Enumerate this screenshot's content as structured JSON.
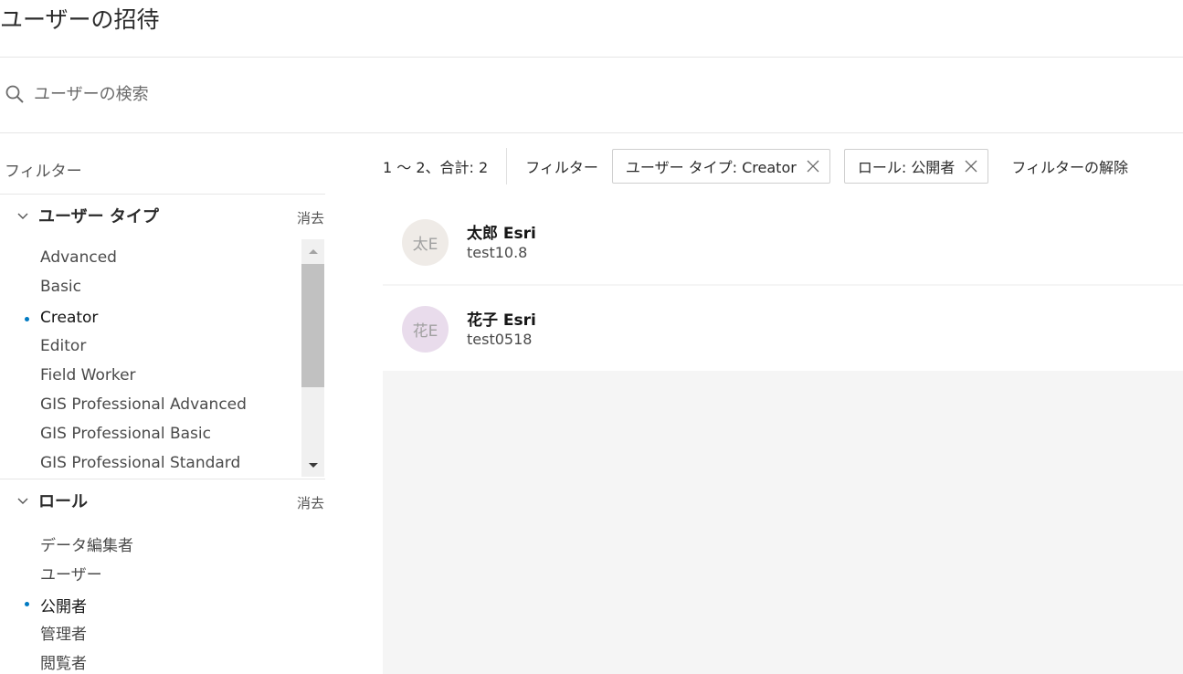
{
  "title": "ユーザーの招待",
  "search": {
    "placeholder": "ユーザーの検索"
  },
  "filters": {
    "heading": "フィルター",
    "user_type": {
      "label": "ユーザー タイプ",
      "clear_label": "消去",
      "options": [
        {
          "label": "Advanced",
          "selected": false
        },
        {
          "label": "Basic",
          "selected": false
        },
        {
          "label": "Creator",
          "selected": true
        },
        {
          "label": "Editor",
          "selected": false
        },
        {
          "label": "Field Worker",
          "selected": false
        },
        {
          "label": "GIS Professional Advanced",
          "selected": false
        },
        {
          "label": "GIS Professional Basic",
          "selected": false
        },
        {
          "label": "GIS Professional Standard",
          "selected": false
        }
      ]
    },
    "role": {
      "label": "ロール",
      "clear_label": "消去",
      "options": [
        {
          "label": "データ編集者",
          "selected": false
        },
        {
          "label": "ユーザー",
          "selected": false
        },
        {
          "label": "公開者",
          "selected": true
        },
        {
          "label": "管理者",
          "selected": false
        },
        {
          "label": "閲覧者",
          "selected": false
        }
      ]
    }
  },
  "results": {
    "count_text": "1 ～ 2、合計: 2",
    "filter_label": "フィルター",
    "chips": [
      {
        "label": "ユーザー タイプ: Creator"
      },
      {
        "label": "ロール: 公開者"
      }
    ],
    "clear_filters_label": "フィルターの解除",
    "users": [
      {
        "initials": "太E",
        "name": "太郎 Esri",
        "username": "test10.8",
        "avatar_color": "#efebe7"
      },
      {
        "initials": "花E",
        "name": "花子 Esri",
        "username": "test0518",
        "avatar_color": "#e9dcec"
      }
    ]
  },
  "colors": {
    "accent": "#007ac2",
    "border": "#e6e6e6",
    "main_background": "#f5f5f5"
  },
  "icons": {
    "search": "search-icon",
    "chevron": "chevron-down-icon",
    "close": "close-icon",
    "scroll_up": "caret-up-icon",
    "scroll_down": "caret-down-icon"
  }
}
